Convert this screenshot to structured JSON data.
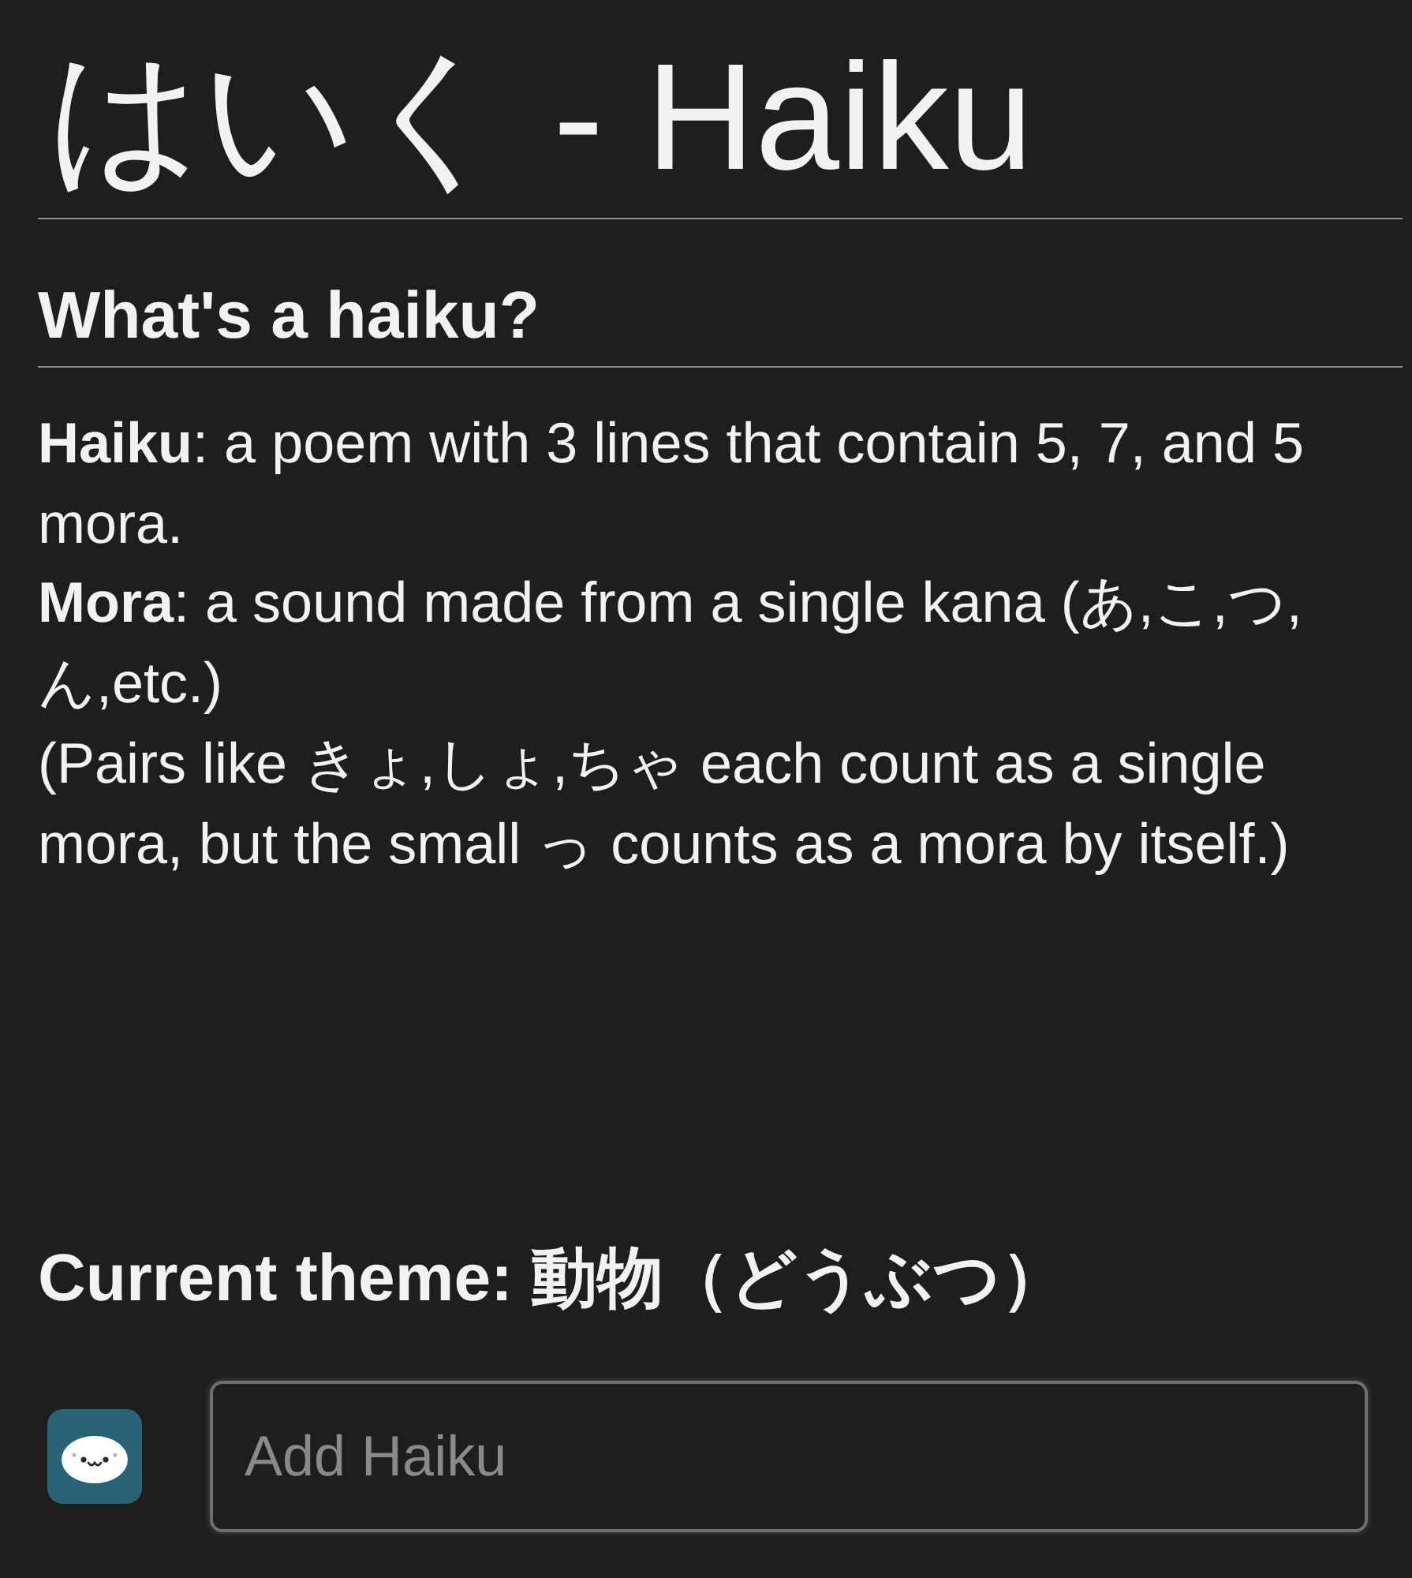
{
  "title": "はいく - Haiku",
  "about": {
    "heading": "What's a haiku?",
    "paragraphs": [
      "**Haiku**: a poem with 3 lines that contain 5, 7, and 5 mora.",
      "**Mora**: a sound made from a single kana (あ,こ,つ,ん,etc.)",
      "(Pairs like きょ,しょ,ちゃ each count as a single mora, but the small っ counts as a mora by itself.)"
    ]
  },
  "theme": {
    "heading": "Current theme: 動物（どうぶつ）"
  },
  "composer": {
    "placeholder": "Add Haiku"
  }
}
